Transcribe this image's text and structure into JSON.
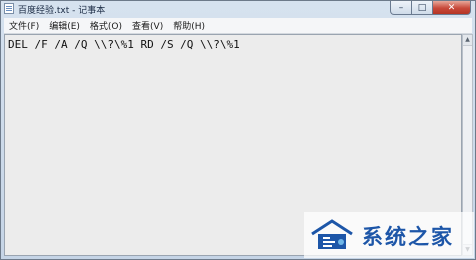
{
  "window": {
    "title": "百度经验.txt - 记事本"
  },
  "title_buttons": {
    "minimize": "–",
    "maximize": "□",
    "close": "✕"
  },
  "menu": {
    "items": [
      {
        "label": "文件(F)"
      },
      {
        "label": "编辑(E)"
      },
      {
        "label": "格式(O)"
      },
      {
        "label": "查看(V)"
      },
      {
        "label": "帮助(H)"
      }
    ]
  },
  "editor": {
    "content": "DEL /F /A /Q \\\\?\\%1 RD /S /Q \\\\?\\%1"
  },
  "watermark": {
    "text": "系统之家",
    "accent": "#1d56a8"
  },
  "icons": {
    "app": "notepad-icon",
    "watermark_logo": "house-logo-icon"
  }
}
